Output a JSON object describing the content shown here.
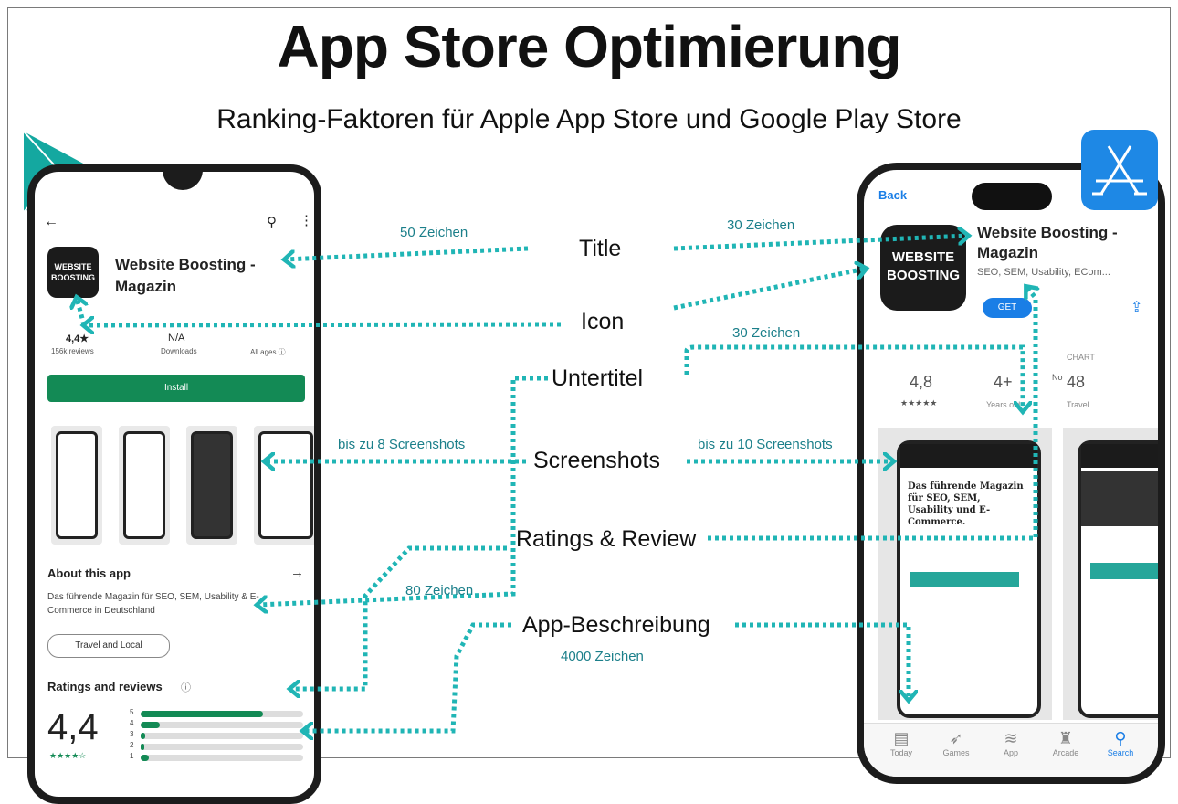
{
  "header": {
    "title": "App Store Optimierung",
    "subtitle": "Ranking-Faktoren für Apple App Store und Google Play Store"
  },
  "factors": {
    "title": "Title",
    "icon": "Icon",
    "untertitel": "Untertitel",
    "screenshots": "Screenshots",
    "ratings": "Ratings & Review",
    "beschreibung": "App-Beschreibung"
  },
  "counts": {
    "android_title": "50 Zeichen",
    "ios_title": "30 Zeichen",
    "ios_subtitle": "30 Zeichen",
    "android_screens": "bis zu 8 Screenshots",
    "ios_screens": "bis zu 10 Screenshots",
    "android_desc": "80 Zeichen",
    "desc_long": "4000 Zeichen"
  },
  "android": {
    "app_name": "Website Boosting - Magazin",
    "logo_text": "WEBSITE BOOSTING",
    "rating": "4,4★",
    "reviews": "156k reviews",
    "downloads_value": "N/A",
    "downloads_label": "Downloads",
    "age_label": "All ages ⓘ",
    "install": "Install",
    "about_title": "About this app",
    "about_text": "Das führende Magazin für SEO, SEM, Usability & E-Commerce in Deutschland",
    "chip": "Travel and Local",
    "ratings_title": "Ratings and reviews",
    "big_rating": "4,4",
    "small_stars": "★★★★☆",
    "bars": [
      {
        "label": "5",
        "fill": 0.75
      },
      {
        "label": "4",
        "fill": 0.12
      },
      {
        "label": "3",
        "fill": 0.03
      },
      {
        "label": "2",
        "fill": 0.02
      },
      {
        "label": "1",
        "fill": 0.05
      }
    ]
  },
  "ios": {
    "back": "Back",
    "app_name": "Website Boosting - Magazin",
    "logo_text": "WEBSITE BOOSTING",
    "subtitle": "SEO, SEM, Usability, ECom...",
    "get": "GET",
    "rating": "4,8",
    "stars": "★★★★★",
    "age": "4+",
    "age_label": "Years old",
    "chart_label": "CHART",
    "chart_no": "No",
    "chart_value": "48",
    "chart_cat": "Travel",
    "tabs": [
      "Today",
      "Games",
      "App",
      "Arcade",
      "Search"
    ],
    "shot_text": "Das führende Magazin für SEO, SEM, Usability und E-Commerce."
  },
  "colors": {
    "arrow": "#20b5b5",
    "play_green": "#138a55",
    "ios_blue": "#1a7ee6",
    "appstore_badge": "#1e88e5"
  }
}
